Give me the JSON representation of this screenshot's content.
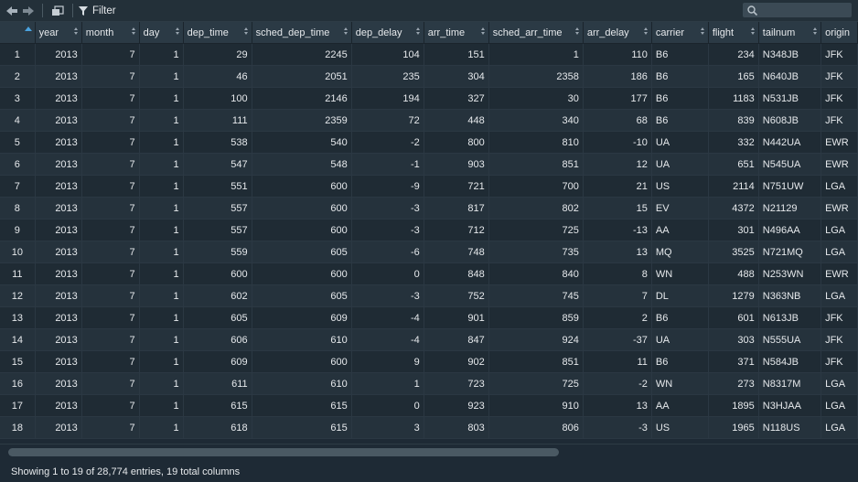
{
  "toolbar": {
    "filter_label": "Filter",
    "search": {
      "placeholder": "",
      "value": ""
    }
  },
  "table": {
    "columns": [
      "year",
      "month",
      "day",
      "dep_time",
      "sched_dep_time",
      "dep_delay",
      "arr_time",
      "sched_arr_time",
      "arr_delay",
      "carrier",
      "flight",
      "tailnum",
      "origin"
    ],
    "rows": [
      [
        "1",
        "2013",
        "7",
        "1",
        "29",
        "2245",
        "104",
        "151",
        "1",
        "110",
        "B6",
        "234",
        "N348JB",
        "JFK"
      ],
      [
        "2",
        "2013",
        "7",
        "1",
        "46",
        "2051",
        "235",
        "304",
        "2358",
        "186",
        "B6",
        "165",
        "N640JB",
        "JFK"
      ],
      [
        "3",
        "2013",
        "7",
        "1",
        "100",
        "2146",
        "194",
        "327",
        "30",
        "177",
        "B6",
        "1183",
        "N531JB",
        "JFK"
      ],
      [
        "4",
        "2013",
        "7",
        "1",
        "111",
        "2359",
        "72",
        "448",
        "340",
        "68",
        "B6",
        "839",
        "N608JB",
        "JFK"
      ],
      [
        "5",
        "2013",
        "7",
        "1",
        "538",
        "540",
        "-2",
        "800",
        "810",
        "-10",
        "UA",
        "332",
        "N442UA",
        "EWR"
      ],
      [
        "6",
        "2013",
        "7",
        "1",
        "547",
        "548",
        "-1",
        "903",
        "851",
        "12",
        "UA",
        "651",
        "N545UA",
        "EWR"
      ],
      [
        "7",
        "2013",
        "7",
        "1",
        "551",
        "600",
        "-9",
        "721",
        "700",
        "21",
        "US",
        "2114",
        "N751UW",
        "LGA"
      ],
      [
        "8",
        "2013",
        "7",
        "1",
        "557",
        "600",
        "-3",
        "817",
        "802",
        "15",
        "EV",
        "4372",
        "N21129",
        "EWR"
      ],
      [
        "9",
        "2013",
        "7",
        "1",
        "557",
        "600",
        "-3",
        "712",
        "725",
        "-13",
        "AA",
        "301",
        "N496AA",
        "LGA"
      ],
      [
        "10",
        "2013",
        "7",
        "1",
        "559",
        "605",
        "-6",
        "748",
        "735",
        "13",
        "MQ",
        "3525",
        "N721MQ",
        "LGA"
      ],
      [
        "11",
        "2013",
        "7",
        "1",
        "600",
        "600",
        "0",
        "848",
        "840",
        "8",
        "WN",
        "488",
        "N253WN",
        "EWR"
      ],
      [
        "12",
        "2013",
        "7",
        "1",
        "602",
        "605",
        "-3",
        "752",
        "745",
        "7",
        "DL",
        "1279",
        "N363NB",
        "LGA"
      ],
      [
        "13",
        "2013",
        "7",
        "1",
        "605",
        "609",
        "-4",
        "901",
        "859",
        "2",
        "B6",
        "601",
        "N613JB",
        "JFK"
      ],
      [
        "14",
        "2013",
        "7",
        "1",
        "606",
        "610",
        "-4",
        "847",
        "924",
        "-37",
        "UA",
        "303",
        "N555UA",
        "JFK"
      ],
      [
        "15",
        "2013",
        "7",
        "1",
        "609",
        "600",
        "9",
        "902",
        "851",
        "11",
        "B6",
        "371",
        "N584JB",
        "JFK"
      ],
      [
        "16",
        "2013",
        "7",
        "1",
        "611",
        "610",
        "1",
        "723",
        "725",
        "-2",
        "WN",
        "273",
        "N8317M",
        "LGA"
      ],
      [
        "17",
        "2013",
        "7",
        "1",
        "615",
        "615",
        "0",
        "923",
        "910",
        "13",
        "AA",
        "1895",
        "N3HJAA",
        "LGA"
      ],
      [
        "18",
        "2013",
        "7",
        "1",
        "618",
        "615",
        "3",
        "803",
        "806",
        "-3",
        "US",
        "1965",
        "N118US",
        "LGA"
      ]
    ]
  },
  "status": {
    "text": "Showing 1 to 19 of 28,774 entries, 19 total columns"
  },
  "colors": {
    "background": "#1e2a35",
    "header": "#2b3a45",
    "row_odd": "#1f2b34",
    "row_even": "#25323c"
  }
}
